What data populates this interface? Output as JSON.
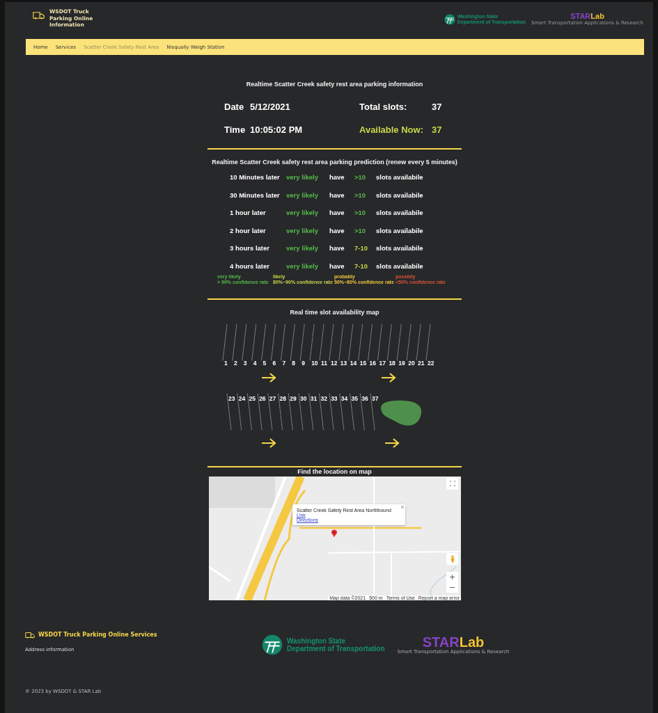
{
  "header": {
    "brand": "WSDOT Truck Parking Online Information",
    "wsdot_logo": [
      "Washington State",
      "Department of Transportation"
    ],
    "star_logo": {
      "star": "STAR",
      "lab": "Lab",
      "subtitle": "Smart Transportation Applications & Research"
    }
  },
  "nav": [
    {
      "label": "Home",
      "selected": false
    },
    {
      "label": "Services",
      "selected": false
    },
    {
      "label": "Scatter Creek Safety Rest Area",
      "selected": true
    },
    {
      "label": "Nisqually Weigh Station",
      "selected": false
    }
  ],
  "realtime": {
    "title": "Realtime Scatter Creek safety rest area parking information",
    "date_label": "Date",
    "date": "5/12/2021",
    "total_label": "Total slots:",
    "total": "37",
    "time_label": "Time",
    "time": "10:05:02 PM",
    "available_label": "Available Now:",
    "available": "37"
  },
  "prediction": {
    "title": "Realtime Scatter Creek safety rest area parking prediction (renew every 5 minutes)",
    "rows": [
      {
        "when": "10 Minutes later",
        "likelihood": {
          "text": "very likely",
          "color": "#55b94a"
        },
        "verb": "have",
        "count": {
          "text": ">10",
          "color": "#55b94a"
        },
        "unit": "slots availabile"
      },
      {
        "when": "30 Minutes later",
        "likelihood": {
          "text": "very likely",
          "color": "#55b94a"
        },
        "verb": "have",
        "count": {
          "text": ">10",
          "color": "#55b94a"
        },
        "unit": "slots availabile"
      },
      {
        "when": "1 hour later",
        "likelihood": {
          "text": "very likely",
          "color": "#55b94a"
        },
        "verb": "have",
        "count": {
          "text": ">10",
          "color": "#55b94a"
        },
        "unit": "slots availabile"
      },
      {
        "when": "2 hour later",
        "likelihood": {
          "text": "very likely",
          "color": "#55b94a"
        },
        "verb": "have",
        "count": {
          "text": ">10",
          "color": "#55b94a"
        },
        "unit": "slots availabile"
      },
      {
        "when": "3 hours later",
        "likelihood": {
          "text": "very likely",
          "color": "#55b94a"
        },
        "verb": "have",
        "count": {
          "text": "7-10",
          "color": "#c8d64a"
        },
        "unit": "slots availabile"
      },
      {
        "when": "4 hours later",
        "likelihood": {
          "text": "very likely",
          "color": "#55b94a"
        },
        "verb": "have",
        "count": {
          "text": "7-10",
          "color": "#c8d64a"
        },
        "unit": "slots availabile"
      }
    ],
    "legend": [
      {
        "term": "very likely",
        "rate": "> 90% confidence rate",
        "color": "#55b94a"
      },
      {
        "term": "likely",
        "rate": "80%~90% confidence rate",
        "color": "#c8d64a"
      },
      {
        "term": "probably",
        "rate": "50%~80% confidence rate",
        "color": "#f0c93c"
      },
      {
        "term": "possibly",
        "rate": "<50% confidence rate",
        "color": "#d9533a"
      }
    ]
  },
  "slot_map": {
    "title": "Real time slot availability map",
    "top_row": [
      "1",
      "2",
      "3",
      "4",
      "5",
      "6",
      "7",
      "8",
      "9",
      "10",
      "11",
      "12",
      "13",
      "14",
      "15",
      "16",
      "17",
      "18",
      "19",
      "20",
      "21",
      "22"
    ],
    "bottom_row": [
      "23",
      "24",
      "25",
      "26",
      "27",
      "28",
      "29",
      "30",
      "31",
      "32",
      "33",
      "34",
      "35",
      "36",
      "37"
    ]
  },
  "location": {
    "title": "Find the location on map",
    "info": {
      "title": "Scatter Creek Safety Rest Area Northbound",
      "link": "Link",
      "directions": "Directions"
    },
    "zoom_in": "+",
    "zoom_out": "−",
    "attribution": [
      "Map data ©2021",
      "500 m",
      "Terms of Use",
      "Report a map error"
    ]
  },
  "footer": {
    "brand": "WSDOT Truck Parking Online Services",
    "address": "Address information",
    "wsdot_logo": [
      "Washington State",
      "Department of Transportation"
    ],
    "star_logo": {
      "star": "STAR",
      "lab": "Lab",
      "subtitle": "Smart Transportation Applications & Research"
    },
    "copyright": "© 2023 by WSDOT & STAR Lab"
  }
}
